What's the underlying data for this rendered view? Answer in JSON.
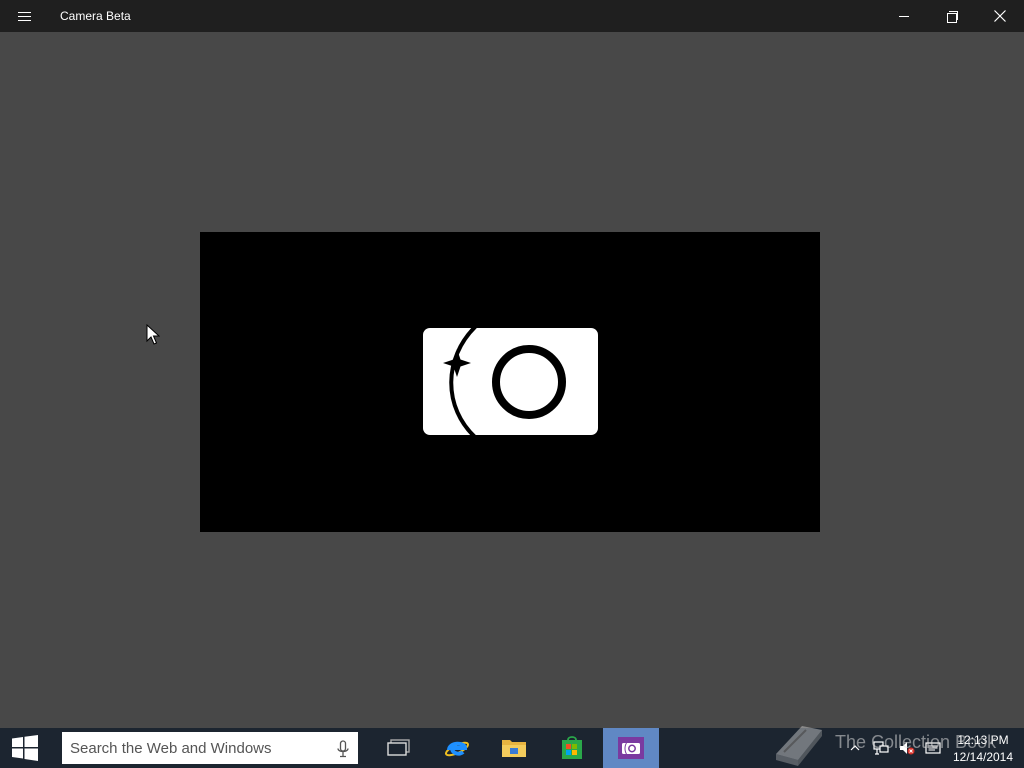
{
  "window": {
    "title": "Camera Beta",
    "menu_icon": "hamburger-icon",
    "controls": [
      "minimize-icon",
      "restore-icon",
      "close-icon"
    ]
  },
  "viewport": {
    "logo_icon": "camera-app-icon"
  },
  "taskbar": {
    "start_icon": "windows-logo-icon",
    "search": {
      "placeholder": "Search the Web and Windows",
      "icon": "microphone-icon"
    },
    "apps": [
      {
        "name": "Task View",
        "icon": "task-view-icon"
      },
      {
        "name": "Internet Explorer",
        "icon": "internet-explorer-icon"
      },
      {
        "name": "File Explorer",
        "icon": "file-explorer-icon"
      },
      {
        "name": "Store",
        "icon": "store-icon"
      },
      {
        "name": "Camera",
        "icon": "camera-icon",
        "active": true
      }
    ],
    "tray_icons": [
      "show-hidden-icons-chevron",
      "network-icon",
      "volume-muted-icon",
      "action-center-icon"
    ],
    "clock": {
      "time": "12:13 PM",
      "date": "12/14/2014"
    }
  },
  "watermark": {
    "text": "The Collection Book"
  },
  "colors": {
    "background": "#484848",
    "titlebar": "#1f1f1f",
    "taskbar": "#1c2530",
    "active_app": "#6088c4",
    "camera_tile": "#7a3aa0"
  }
}
